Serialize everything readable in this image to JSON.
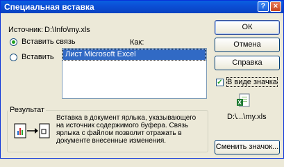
{
  "window": {
    "title": "Специальная вставка"
  },
  "titlebar": {
    "help": "?",
    "close": "×"
  },
  "source": {
    "label": "Источник:",
    "path": "D:\\Info\\my.xls"
  },
  "options": {
    "paste_link": "Вставить связь",
    "paste": "Вставить",
    "selected": "paste_link"
  },
  "as": {
    "label": "Как:",
    "items": [
      "Лист Microsoft Excel"
    ]
  },
  "buttons": {
    "ok": "ОК",
    "cancel": "Отмена",
    "help": "Справка",
    "change_icon": "Сменить значок..."
  },
  "display_as_icon": {
    "label": "В виде значка",
    "checked": true
  },
  "icon_preview": {
    "caption": "D:\\...\\my.xls"
  },
  "result": {
    "label": "Результат",
    "text": "Вставка в документ ярлыка, указывающего на источник содержимого буфера. Связь ярлыка с файлом позволит отражать в документе внесенные изменения."
  },
  "colors": {
    "titlebar": "#0b4fd6",
    "selection": "#316ac5",
    "face": "#ece9d8"
  }
}
